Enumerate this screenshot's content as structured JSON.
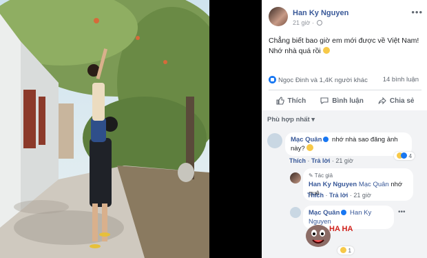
{
  "post": {
    "author": "Han Ky Nguyen",
    "time": "21 giờ",
    "text_line1": "Chẳng biết bao giờ em mới được về Việt Nam!",
    "text_line2": "Nhớ nhà quá rồi",
    "reactions_text": "Ngọc Đinh và 1,4K người khác",
    "comments_count": "14 bình luận",
    "more": "•••"
  },
  "actions": {
    "like": "Thích",
    "comment": "Bình luận",
    "share": "Chia sẻ"
  },
  "comments": {
    "sort": "Phù hợp nhất ▾",
    "c1": {
      "name": "Mạc Quân",
      "text": "nhớ nhà sao đăng ảnh này?",
      "like": "Thích",
      "reply": "Trả lời",
      "time": "21 giờ",
      "reaction_count": "4"
    },
    "c2": {
      "tag": "Tác giả",
      "name": "Han Ky Nguyen",
      "mention": "Mạc Quân",
      "text": "nhớ quê",
      "like": "Thích",
      "reply": "Trả lời",
      "time": "21 giờ"
    },
    "c3": {
      "name": "Mạc Quân",
      "mention": "Han Ky Nguyen",
      "sticker_text": "HA HA",
      "reaction_count": "1"
    }
  },
  "colors": {
    "brand": "#1877f2",
    "name_link": "#385898"
  }
}
